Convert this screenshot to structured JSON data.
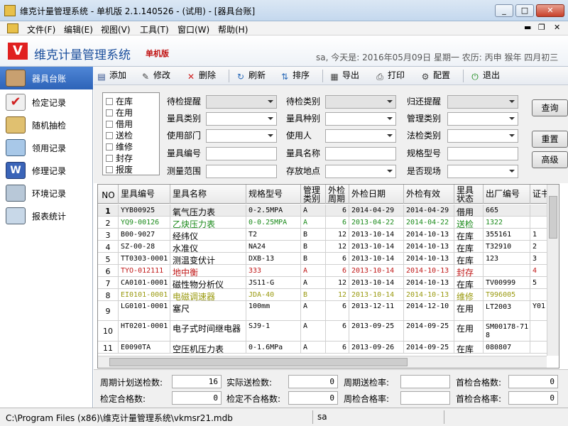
{
  "window": {
    "title": "维克计量管理系统 - 单机版 2.1.140526 - (试用) - [器具台账]",
    "min_icon": "minimize-icon",
    "max_icon": "maximize-icon",
    "close_icon": "close-icon"
  },
  "menu": {
    "items": [
      "文件(F)",
      "编辑(E)",
      "视图(V)",
      "工具(T)",
      "窗口(W)",
      "帮助(H)"
    ],
    "mdi_icons": [
      "mdi-minimize-icon",
      "mdi-restore-icon",
      "mdi-close-icon"
    ]
  },
  "banner": {
    "logo": "V",
    "app_name": "维克计量管理系统",
    "edition": "单机版",
    "status": "sa, 今天是: 2016年05月09日 星期一  农历: 丙申 猴年 四月初三"
  },
  "sidebar": {
    "items": [
      {
        "label": "器具台账",
        "icon": "instrument-ledger-icon",
        "active": true
      },
      {
        "label": "检定记录",
        "icon": "verification-record-icon",
        "active": false
      },
      {
        "label": "随机抽检",
        "icon": "random-inspection-icon",
        "active": false
      },
      {
        "label": "领用记录",
        "icon": "requisition-record-icon",
        "active": false
      },
      {
        "label": "修理记录",
        "icon": "repair-record-icon",
        "active": false
      },
      {
        "label": "环境记录",
        "icon": "environment-record-icon",
        "active": false
      },
      {
        "label": "报表统计",
        "icon": "report-statistics-icon",
        "active": false
      }
    ]
  },
  "toolbar": {
    "items": [
      {
        "label": "添加",
        "icon": "add-icon"
      },
      {
        "label": "修改",
        "icon": "edit-icon"
      },
      {
        "label": "删除",
        "icon": "delete-icon"
      },
      {
        "label": "刷新",
        "icon": "refresh-icon"
      },
      {
        "label": "排序",
        "icon": "sort-icon"
      },
      {
        "label": "导出",
        "icon": "export-icon"
      },
      {
        "label": "打印",
        "icon": "print-icon"
      },
      {
        "label": "配置",
        "icon": "config-icon"
      },
      {
        "label": "退出",
        "icon": "exit-icon"
      }
    ]
  },
  "filter": {
    "checkboxes": [
      "在库",
      "在用",
      "借用",
      "送检",
      "维修",
      "封存",
      "报废"
    ],
    "fields": [
      {
        "label": "待检提醒",
        "type": "select"
      },
      {
        "label": "待检类别",
        "type": "select"
      },
      {
        "label": "归还提醒",
        "type": "select"
      },
      {
        "label": "量具类别",
        "type": "select"
      },
      {
        "label": "量具种别",
        "type": "select"
      },
      {
        "label": "管理类别",
        "type": "select"
      },
      {
        "label": "使用部门",
        "type": "select"
      },
      {
        "label": "使用人",
        "type": "select"
      },
      {
        "label": "法检类别",
        "type": "select"
      },
      {
        "label": "量具编号",
        "type": "input"
      },
      {
        "label": "量具名称",
        "type": "input"
      },
      {
        "label": "规格型号",
        "type": "input"
      },
      {
        "label": "测量范围",
        "type": "input"
      },
      {
        "label": "存放地点",
        "type": "select"
      },
      {
        "label": "是否现场",
        "type": "select"
      }
    ],
    "buttons": [
      "查询",
      "重置",
      "高级"
    ]
  },
  "table": {
    "columns": [
      "NO",
      "里具编号",
      "里具名称",
      "规格型号",
      "管理类别",
      "外检周期",
      "外检日期",
      "外检有效",
      "里具状态",
      "出厂编号",
      "证书"
    ],
    "rows": [
      {
        "no": "1",
        "code": "YYB00925",
        "name": "氧气压力表",
        "spec": "0-2.5MPA",
        "cat": "A",
        "cycle": "6",
        "date": "2014-04-29",
        "valid": "2014-04-29",
        "status": "借用",
        "factory": "665",
        "cert": "",
        "color": "#000000",
        "selected": true
      },
      {
        "no": "2",
        "code": "YQ9-00126",
        "name": "乙炔压力表",
        "spec": "0-0.25MPA",
        "cat": "A",
        "cycle": "6",
        "date": "2013-04-22",
        "valid": "2014-04-22",
        "status": "送检",
        "factory": "1322",
        "cert": "",
        "color": "#1a8a1a",
        "selected": false
      },
      {
        "no": "3",
        "code": "B00-9027",
        "name": "经纬仪",
        "spec": "T2",
        "cat": "B",
        "cycle": "12",
        "date": "2013-10-14",
        "valid": "2014-10-13",
        "status": "在库",
        "factory": "355161",
        "cert": "1",
        "color": "#000000",
        "selected": false
      },
      {
        "no": "4",
        "code": "SZ-00-28",
        "name": "水准仪",
        "spec": "NA24",
        "cat": "B",
        "cycle": "12",
        "date": "2013-10-14",
        "valid": "2014-10-13",
        "status": "在库",
        "factory": "T32910",
        "cert": "2",
        "color": "#000000",
        "selected": false
      },
      {
        "no": "5",
        "code": "TT0303-0001",
        "name": "测温变伏计",
        "spec": "DXB-13",
        "cat": "B",
        "cycle": "6",
        "date": "2013-10-14",
        "valid": "2014-10-13",
        "status": "在库",
        "factory": "123",
        "cert": "3",
        "color": "#000000",
        "selected": false
      },
      {
        "no": "6",
        "code": "TYO-012111",
        "name": "地中衡",
        "spec": "333",
        "cat": "A",
        "cycle": "6",
        "date": "2013-10-14",
        "valid": "2014-10-13",
        "status": "封存",
        "factory": "",
        "cert": "4",
        "color": "#c01818",
        "selected": false
      },
      {
        "no": "7",
        "code": "CA0101-0001",
        "name": "磁性物分析仪",
        "spec": "JS11-G",
        "cat": "A",
        "cycle": "12",
        "date": "2013-10-14",
        "valid": "2014-10-13",
        "status": "在库",
        "factory": "TV00999",
        "cert": "5",
        "color": "#000000",
        "selected": false
      },
      {
        "no": "8",
        "code": "EI0101-0001",
        "name": "电磁调速器",
        "spec": "JDA-40",
        "cat": "B",
        "cycle": "12",
        "date": "2013-10-14",
        "valid": "2014-10-13",
        "status": "维修",
        "factory": "T996005",
        "cert": "",
        "color": "#9a9a10",
        "selected": false
      },
      {
        "no": "9",
        "code": "LG0101-0001",
        "name": "塞尺",
        "spec": "100mm",
        "cat": "A",
        "cycle": "6",
        "date": "2013-12-11",
        "valid": "2014-12-10",
        "status": "在用",
        "factory": "LT2003",
        "cert": "Y01",
        "color": "#000000",
        "selected": false
      },
      {
        "no": "10",
        "code": "HT0201-0001",
        "name": "电子式时间继电器",
        "spec": "SJ9-1",
        "cat": "A",
        "cycle": "6",
        "date": "2013-09-25",
        "valid": "2014-09-25",
        "status": "在用",
        "factory": "SM00178-718",
        "cert": "",
        "color": "#000000",
        "selected": false
      },
      {
        "no": "11",
        "code": "E0090TA",
        "name": "空压机压力表",
        "spec": "0-1.6MPa",
        "cat": "A",
        "cycle": "6",
        "date": "2013-09-26",
        "valid": "2014-09-25",
        "status": "在库",
        "factory": "080807",
        "cert": "",
        "color": "#000000",
        "selected": false
      }
    ]
  },
  "stats": [
    {
      "label": "周期计划送检数:",
      "value": "16"
    },
    {
      "label": "实际送检数:",
      "value": "0"
    },
    {
      "label": "周期送检率:",
      "value": ""
    },
    {
      "label": "首检合格数:",
      "value": "0"
    },
    {
      "label": "检定合格数:",
      "value": "0"
    },
    {
      "label": "检定不合格数:",
      "value": "0"
    },
    {
      "label": "周检合格率:",
      "value": ""
    },
    {
      "label": "首检合格率:",
      "value": "0"
    }
  ],
  "statusbar": {
    "path": "C:\\Program Files (x86)\\维克计量管理系统\\vkmsr21.mdb",
    "user": "sa"
  },
  "colors": {
    "accent": "#2d63b8",
    "title_bar": "#c4d8ee",
    "brand_red": "#e02020"
  }
}
